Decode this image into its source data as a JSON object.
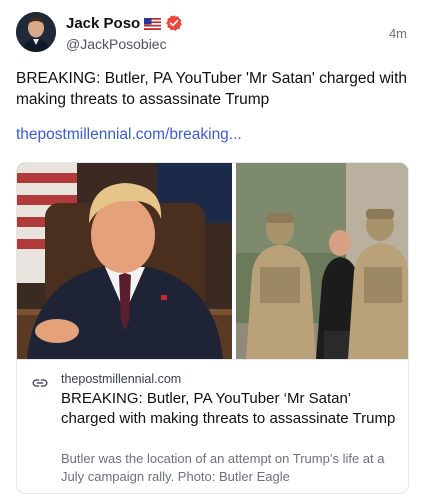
{
  "author": {
    "display_name": "Jack Poso",
    "flag": "🇺🇸",
    "handle": "@JackPosobiec"
  },
  "timestamp": "4m",
  "post": {
    "text": "BREAKING: Butler, PA YouTuber 'Mr Satan' charged with making threats to assassinate Trump",
    "link_text": "thepostmillennial.com/breaking..."
  },
  "card": {
    "domain": "thepostmillennial.com",
    "title": "BREAKING: Butler, PA YouTuber ‘Mr Satan’ charged with making threats to assassinate Trump",
    "description": "Butler was the location of an attempt on Trump’s life at a July campaign rally. Photo: Butler Eagle"
  },
  "colors": {
    "link": "#3b5bdb",
    "verified": "#f0453a",
    "border": "#e5e7eb"
  }
}
